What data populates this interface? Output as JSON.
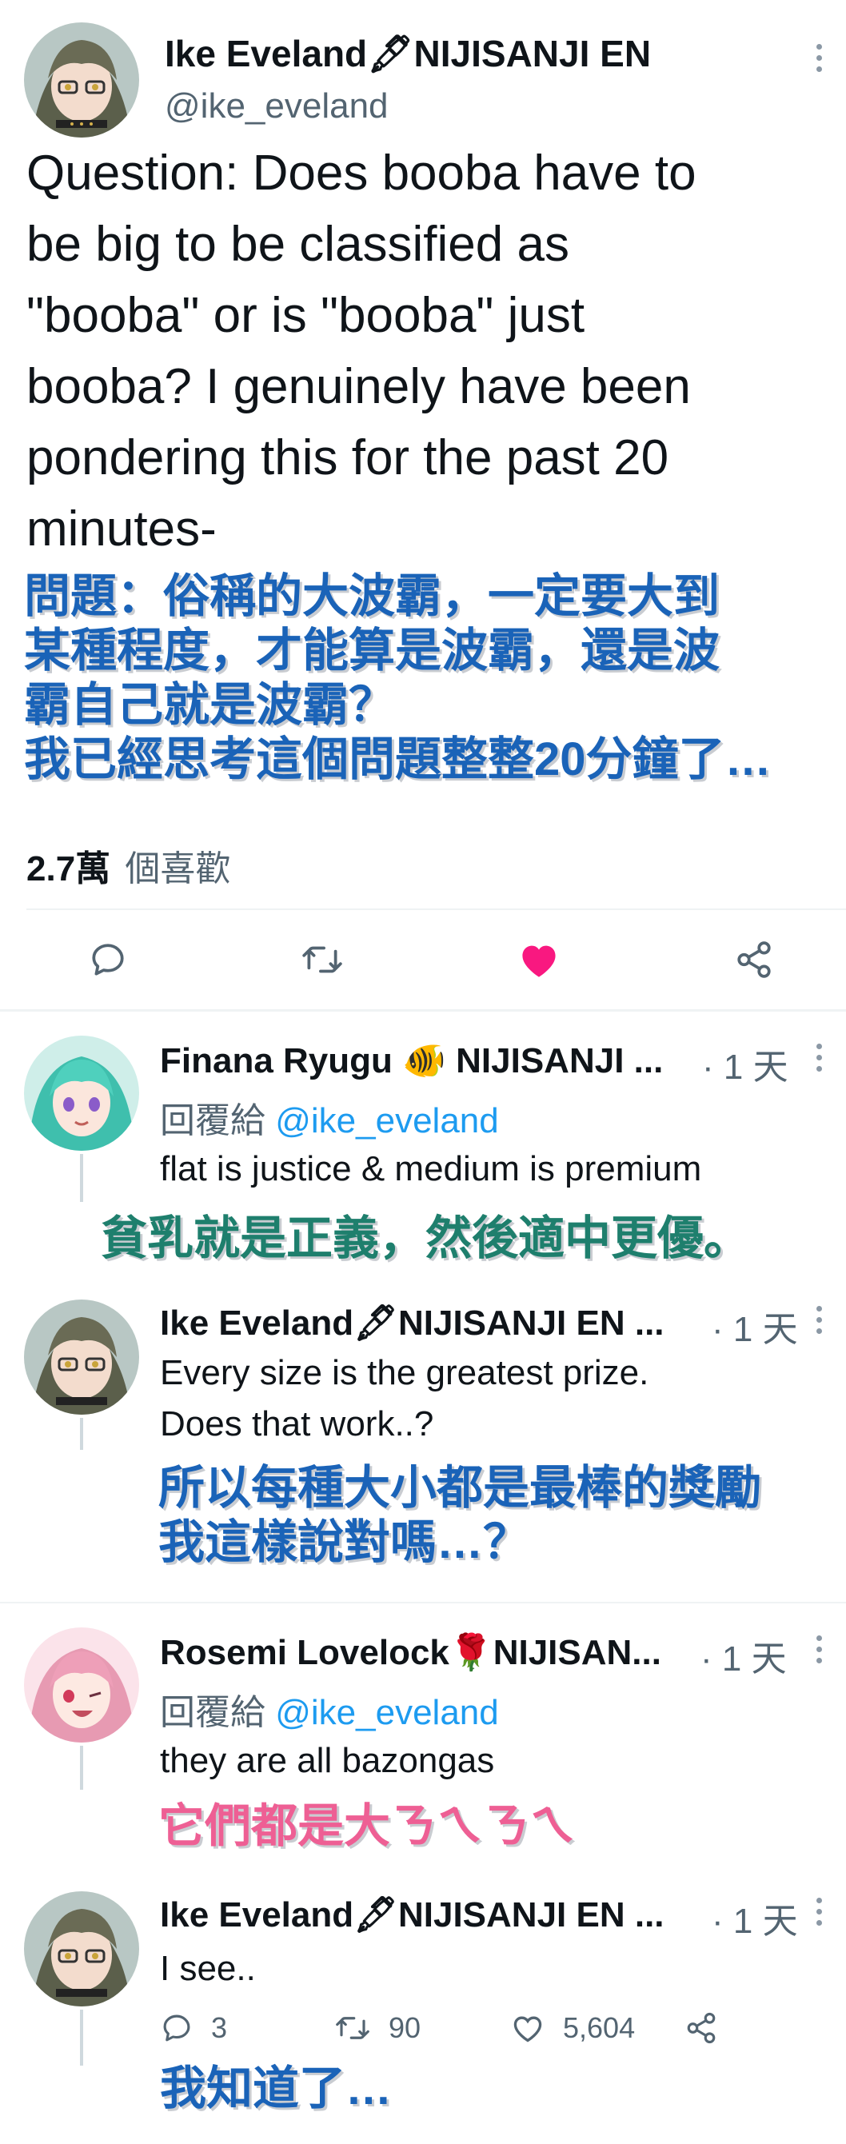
{
  "main_tweet": {
    "author_name": "Ike Eveland🖋NIJISANJI EN",
    "handle": "@ike_eveland",
    "text_lines": [
      "Question: Does booba have to",
      "be big to be classified as",
      "\"booba\" or is \"booba\" just",
      "booba? I genuinely have been",
      "pondering this for the past 20",
      "minutes-"
    ],
    "translation_lines": [
      "問題：俗稱的大波霸，一定要大到",
      "某種程度，才能算是波霸，還是波",
      "霸自己就是波霸？",
      "我已經思考這個問題整整20分鐘了…"
    ],
    "likes_count": "2.7萬",
    "likes_label": "個喜歡"
  },
  "replies": [
    {
      "author_name": "Finana Ryugu 🐠 NIJISANJI ...",
      "time": "· 1 天",
      "reply_to_prefix": "回覆給",
      "reply_to_handle": "@ike_eveland",
      "text": "flat is justice & medium is premium",
      "translation": "貧乳就是正義，然後適中更優。"
    },
    {
      "author_name": "Ike Eveland🖋NIJISANJI EN ...",
      "time": "· 1 天",
      "text_lines": [
        "Every size is the greatest prize.",
        "Does that work..?"
      ],
      "translation_lines": [
        "所以每種大小都是最棒的獎勵",
        "我這樣說對嗎…？"
      ]
    },
    {
      "author_name": "Rosemi Lovelock🌹NIJISAN...",
      "time": "· 1 天",
      "reply_to_prefix": "回覆給",
      "reply_to_handle": "@ike_eveland",
      "text": "they are all bazongas",
      "translation": "它們都是大ㄋㄟㄋㄟ"
    },
    {
      "author_name": "Ike Eveland🖋NIJISANJI EN ...",
      "time": "· 1 天",
      "text": "I see..",
      "reply_count": "3",
      "retweet_count": "90",
      "like_count": "5,604",
      "translation": "我知道了…"
    }
  ],
  "colors": {
    "like_active": "#f91880",
    "link": "#1d9bf0",
    "translation_blue": "#1a63b8",
    "translation_pink": "#ee5f94",
    "translation_green": "#1e7f6d"
  },
  "icons": [
    "reply-icon",
    "retweet-icon",
    "heart-filled-icon",
    "share-icon",
    "more-icon",
    "heart-outline-icon"
  ]
}
